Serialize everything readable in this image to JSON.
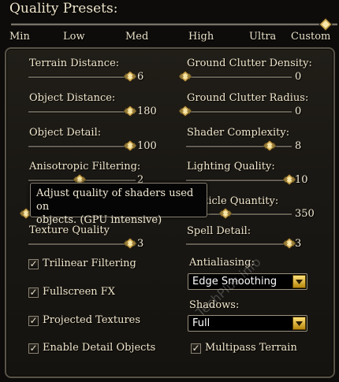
{
  "presets": {
    "title": "Quality Presets:",
    "levels": [
      "Min",
      "Low",
      "Med",
      "High",
      "Ultra",
      "Custom"
    ]
  },
  "sliders_left": [
    {
      "label": "Terrain Distance:",
      "value": "6"
    },
    {
      "label": "Object Distance:",
      "value": "180"
    },
    {
      "label": "Object Detail:",
      "value": "100"
    },
    {
      "label": "Anisotropic Filtering:",
      "value": "2"
    },
    {
      "label": "Texture Quality",
      "value": "3"
    }
  ],
  "sliders_right": [
    {
      "label": "Ground Clutter Density:",
      "value": "0"
    },
    {
      "label": "Ground Clutter Radius:",
      "value": "0"
    },
    {
      "label": "Shader Complexity:",
      "value": "8"
    },
    {
      "label": "Lighting Quality:",
      "value": "10"
    },
    {
      "label": "Particle Quantity:",
      "value": "350"
    },
    {
      "label": "Spell Detail:",
      "value": "3"
    }
  ],
  "checkboxes_left": [
    {
      "label": "Trilinear Filtering",
      "checked": true
    },
    {
      "label": "Fullscreen FX",
      "checked": true
    },
    {
      "label": "Projected Textures",
      "checked": true
    },
    {
      "label": "Enable Detail Objects",
      "checked": true
    }
  ],
  "antialiasing": {
    "label": "Antialiasing:",
    "value": "Edge Smoothing"
  },
  "shadows": {
    "label": "Shadows:",
    "value": "Full"
  },
  "multipass": {
    "label": "Multipass Terrain",
    "checked": true
  },
  "tooltip": {
    "line1": "Adjust quality of shaders used on",
    "line2": "objects. (GPU intensive)"
  },
  "watermark": "TechPlus.info",
  "check_glyph": "✓",
  "colors": {
    "accent_gold": "#f0c24a",
    "text": "#f0e6cc",
    "panel_border": "#5a5448"
  }
}
